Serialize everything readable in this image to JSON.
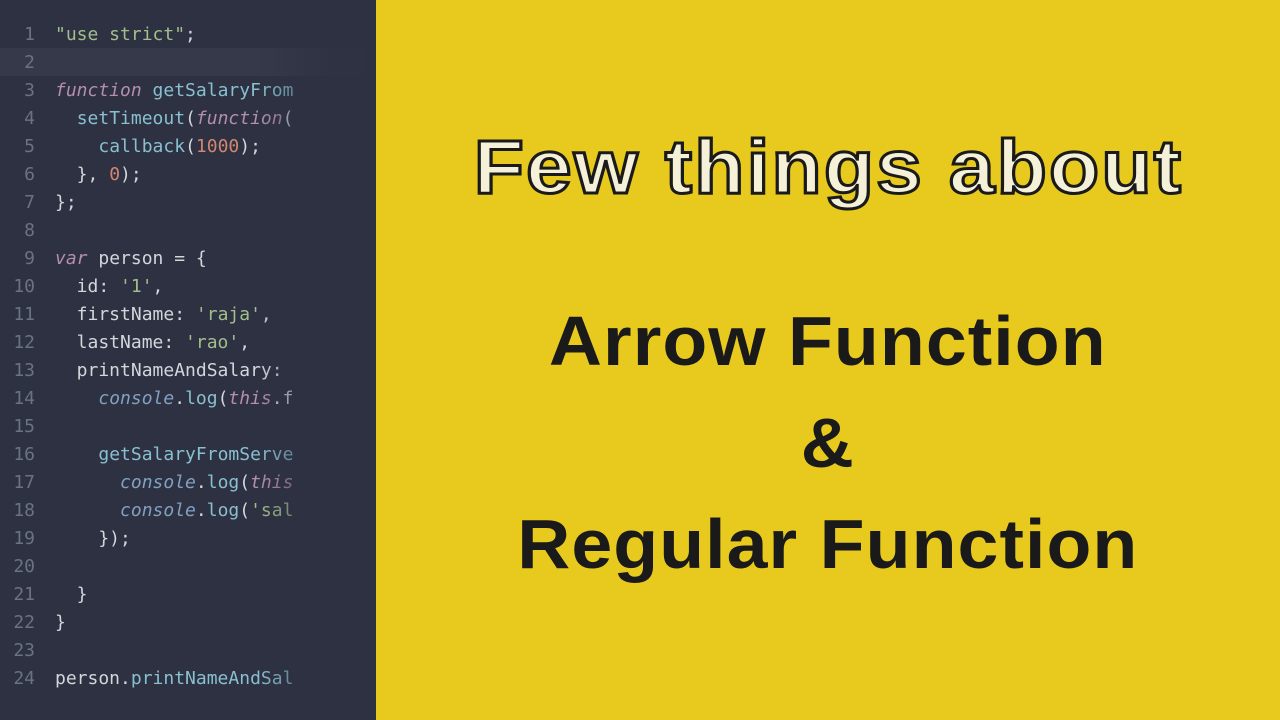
{
  "title": {
    "top": "Few things about",
    "line1": "Arrow Function",
    "line2": "&",
    "line3": "Regular Function"
  },
  "code": {
    "lines": [
      {
        "num": "1",
        "tokens": [
          {
            "t": "\"use strict\"",
            "c": "tok-string"
          },
          {
            "t": ";",
            "c": ""
          }
        ]
      },
      {
        "num": "2",
        "tokens": [],
        "cursor": true
      },
      {
        "num": "3",
        "tokens": [
          {
            "t": "function ",
            "c": "tok-keyword"
          },
          {
            "t": "getSalaryFrom",
            "c": "tok-funcname"
          }
        ]
      },
      {
        "num": "4",
        "tokens": [
          {
            "t": "  ",
            "c": ""
          },
          {
            "t": "setTimeout",
            "c": "tok-method"
          },
          {
            "t": "(",
            "c": ""
          },
          {
            "t": "function",
            "c": "tok-keyword"
          },
          {
            "t": "(",
            "c": ""
          }
        ]
      },
      {
        "num": "5",
        "tokens": [
          {
            "t": "    ",
            "c": ""
          },
          {
            "t": "callback",
            "c": "tok-method"
          },
          {
            "t": "(",
            "c": ""
          },
          {
            "t": "1000",
            "c": "tok-number"
          },
          {
            "t": ");",
            "c": ""
          }
        ]
      },
      {
        "num": "6",
        "tokens": [
          {
            "t": "  }, ",
            "c": ""
          },
          {
            "t": "0",
            "c": "tok-number"
          },
          {
            "t": ");",
            "c": ""
          }
        ]
      },
      {
        "num": "7",
        "tokens": [
          {
            "t": "};",
            "c": ""
          }
        ]
      },
      {
        "num": "8",
        "tokens": []
      },
      {
        "num": "9",
        "tokens": [
          {
            "t": "var ",
            "c": "tok-keyword"
          },
          {
            "t": "person ",
            "c": "tok-property"
          },
          {
            "t": "= {",
            "c": ""
          }
        ]
      },
      {
        "num": "10",
        "tokens": [
          {
            "t": "  id: ",
            "c": ""
          },
          {
            "t": "'1'",
            "c": "tok-string"
          },
          {
            "t": ",",
            "c": ""
          }
        ]
      },
      {
        "num": "11",
        "tokens": [
          {
            "t": "  firstName: ",
            "c": ""
          },
          {
            "t": "'raja'",
            "c": "tok-string"
          },
          {
            "t": ",",
            "c": ""
          }
        ]
      },
      {
        "num": "12",
        "tokens": [
          {
            "t": "  lastName: ",
            "c": ""
          },
          {
            "t": "'rao'",
            "c": "tok-string"
          },
          {
            "t": ",",
            "c": ""
          }
        ]
      },
      {
        "num": "13",
        "tokens": [
          {
            "t": "  printNameAndSalary:",
            "c": ""
          }
        ]
      },
      {
        "num": "14",
        "tokens": [
          {
            "t": "    ",
            "c": ""
          },
          {
            "t": "console",
            "c": "tok-obj"
          },
          {
            "t": ".",
            "c": ""
          },
          {
            "t": "log",
            "c": "tok-method"
          },
          {
            "t": "(",
            "c": ""
          },
          {
            "t": "this",
            "c": "tok-keyword"
          },
          {
            "t": ".f",
            "c": ""
          }
        ]
      },
      {
        "num": "15",
        "tokens": []
      },
      {
        "num": "16",
        "tokens": [
          {
            "t": "    ",
            "c": ""
          },
          {
            "t": "getSalaryFromServe",
            "c": "tok-method"
          }
        ]
      },
      {
        "num": "17",
        "tokens": [
          {
            "t": "      ",
            "c": ""
          },
          {
            "t": "console",
            "c": "tok-obj"
          },
          {
            "t": ".",
            "c": ""
          },
          {
            "t": "log",
            "c": "tok-method"
          },
          {
            "t": "(",
            "c": ""
          },
          {
            "t": "this",
            "c": "tok-keyword"
          }
        ]
      },
      {
        "num": "18",
        "tokens": [
          {
            "t": "      ",
            "c": ""
          },
          {
            "t": "console",
            "c": "tok-obj"
          },
          {
            "t": ".",
            "c": ""
          },
          {
            "t": "log",
            "c": "tok-method"
          },
          {
            "t": "(",
            "c": ""
          },
          {
            "t": "'sal",
            "c": "tok-string"
          }
        ]
      },
      {
        "num": "19",
        "tokens": [
          {
            "t": "    });",
            "c": ""
          }
        ]
      },
      {
        "num": "20",
        "tokens": []
      },
      {
        "num": "21",
        "tokens": [
          {
            "t": "  }",
            "c": ""
          }
        ]
      },
      {
        "num": "22",
        "tokens": [
          {
            "t": "}",
            "c": ""
          }
        ]
      },
      {
        "num": "23",
        "tokens": []
      },
      {
        "num": "24",
        "tokens": [
          {
            "t": "person.",
            "c": ""
          },
          {
            "t": "printNameAndSal",
            "c": "tok-method"
          }
        ]
      }
    ]
  }
}
